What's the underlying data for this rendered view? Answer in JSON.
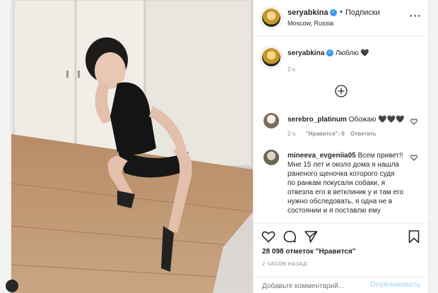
{
  "header": {
    "username": "seryabkina",
    "separator": "•",
    "follow_label": "Подписки",
    "location": "Moscow, Russia",
    "more_label": "···"
  },
  "caption": {
    "username": "seryabkina",
    "text": "Люблю 🖤",
    "time": "2 ч."
  },
  "comments": [
    {
      "username": "serebro_platinum",
      "text": "Обожаю 🖤🖤🖤",
      "time": "2 ч.",
      "likes": "\"Нравится\": 6",
      "reply": "Ответить"
    },
    {
      "username": "mineeva_evgeniia05",
      "text": "Всем привет!! Мне 15 лет и около дома я нашла раненого щеночка которого судя по ранкам покусали собаки, я отвезла его в ветклиник у и там его нужно обследовать, я одна не в состоянии и я поставлю ему"
    }
  ],
  "actions": {
    "likes_text": "28 098 отметок \"Нравится\"",
    "time_ago": "2 ЧАСОВ НАЗАД"
  },
  "comment_box": {
    "placeholder": "Добавьте комментарий...",
    "publish_label": "Опубликовать"
  },
  "colors": {
    "link_blue": "#3897f0",
    "publish_disabled": "#b2dffc",
    "muted": "#8e8e8e"
  }
}
